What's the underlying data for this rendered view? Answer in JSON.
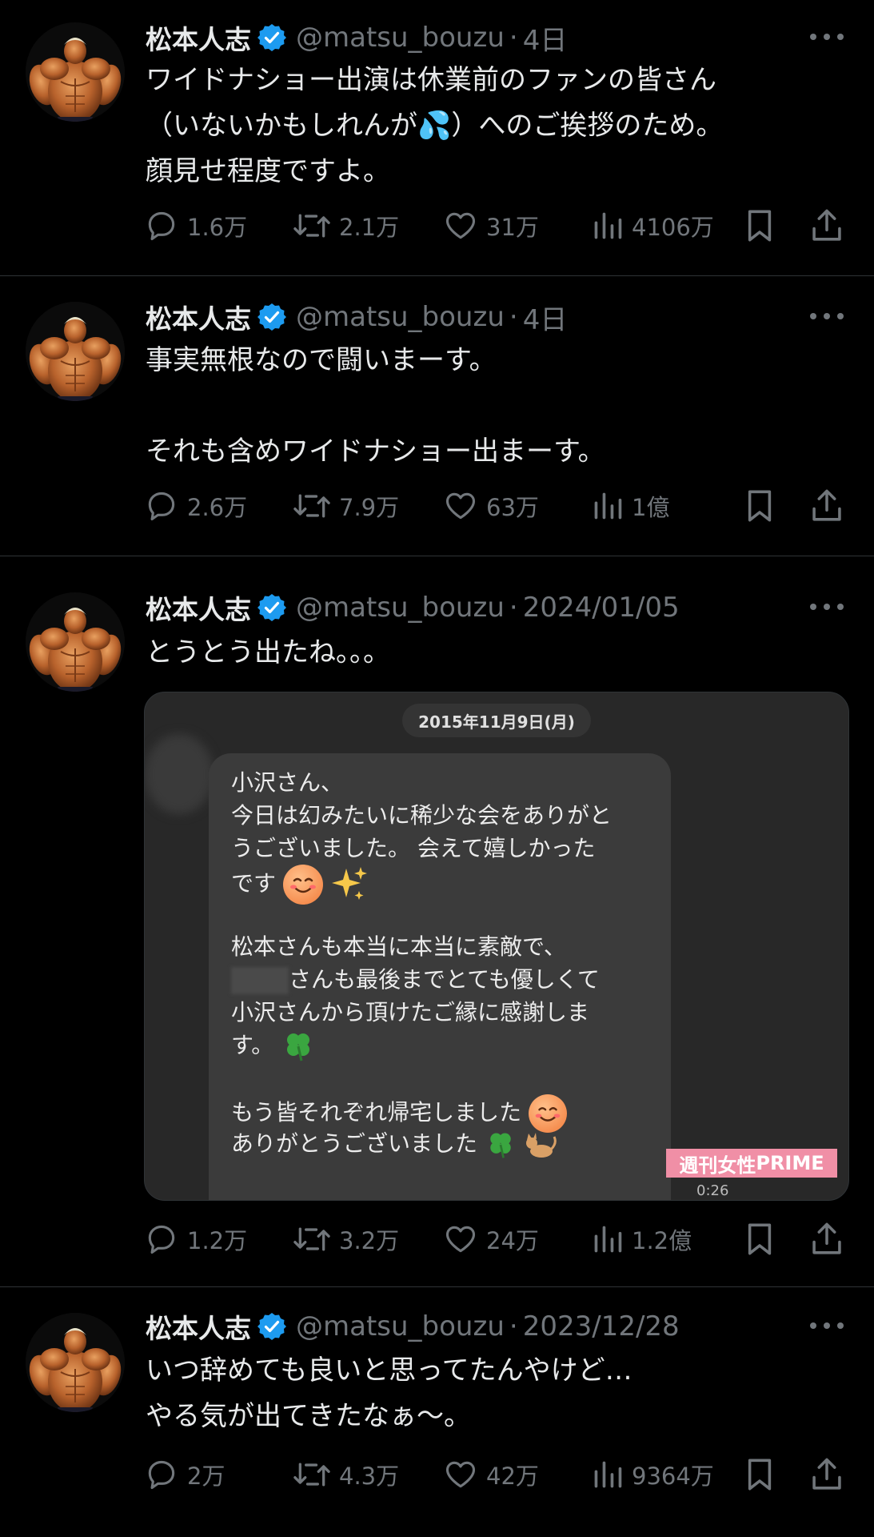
{
  "colors": {
    "background": "#000000",
    "text": "#e7e9ea",
    "muted": "#71767b",
    "verified": "#1d9bf0",
    "divider": "#2f3336"
  },
  "tweets": [
    {
      "name": "松本人志",
      "handle": "@matsu_bouzu",
      "separator": "·",
      "date": "4日",
      "lines": [
        "ワイドナショー出演は休業前のファンの皆さん",
        "（いないかもしれんが💦）へのご挨拶のため。",
        "顔見せ程度ですよ。"
      ],
      "replies": "1.6万",
      "retweets": "2.1万",
      "likes": "31万",
      "views": "4106万"
    },
    {
      "name": "松本人志",
      "handle": "@matsu_bouzu",
      "separator": "·",
      "date": "4日",
      "lines": [
        "事実無根なので闘いまーす。",
        "",
        "それも含めワイドナショー出まーす。"
      ],
      "replies": "2.6万",
      "retweets": "7.9万",
      "likes": "63万",
      "views": "1億"
    },
    {
      "name": "松本人志",
      "handle": "@matsu_bouzu",
      "separator": "·",
      "date": "2024/01/05",
      "lines": [
        "とうとう出たね。。。"
      ],
      "replies": "1.2万",
      "retweets": "3.2万",
      "likes": "24万",
      "views": "1.2億",
      "media": {
        "date_pill": "2015年11月9日(月)",
        "message_lines": [
          "小沢さん、",
          "今日は幻みたいに稀少な会をありがと",
          "うございました。 会えて嬉しかった",
          "です",
          "",
          "松本さんも本当に本当に素敵で、",
          "さんも最後までとても優しくて",
          "小沢さんから頂けたご縁に感謝しま",
          "す。",
          "",
          "もう皆それぞれ帰宅しました",
          "ありがとうございました"
        ],
        "watermark_a": "週刊女性",
        "watermark_b": "PRIME",
        "video_time": "0:26"
      }
    },
    {
      "name": "松本人志",
      "handle": "@matsu_bouzu",
      "separator": "·",
      "date": "2023/12/28",
      "lines": [
        "いつ辞めても良いと思ってたんやけど…",
        "やる気が出てきたなぁ〜。"
      ],
      "replies": "2万",
      "retweets": "4.3万",
      "likes": "42万",
      "views": "9364万"
    }
  ]
}
